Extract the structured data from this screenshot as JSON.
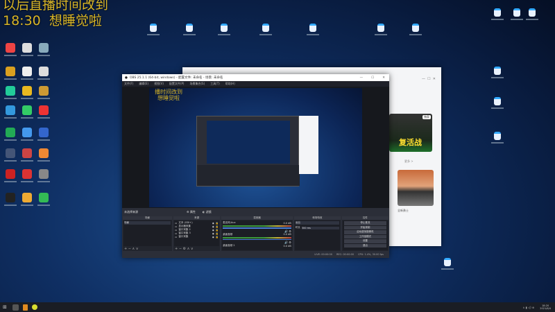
{
  "overlay": {
    "line1": "以后直播时间改到",
    "line2_time": "18:30",
    "line2_text": "想睡觉啦"
  },
  "desktop": {
    "left_icons": [
      "#e44",
      "#ddd",
      "#8ab",
      "#d9a020",
      "#eee",
      "#ddd",
      "#2c9",
      "#e8b820",
      "#c93",
      "#39d",
      "#3c6",
      "#e33",
      "#2a5",
      "#49e",
      "#36c",
      "#457",
      "#c44",
      "#e83",
      "#c22",
      "#d33",
      "#888",
      "#222",
      "#ea3",
      "#3b5"
    ],
    "right_icons": [
      "#3af",
      "#3af",
      "#3af",
      "#3af",
      "#3af",
      "#3af",
      "#3af",
      "#3af",
      "#3af",
      "#3af",
      "#3af",
      "#3af",
      "#3af",
      "#3af"
    ]
  },
  "browser": {
    "banner_text": "复活战",
    "badge": "独家",
    "more": "更多 >",
    "card_caption": "全新勇士"
  },
  "obs": {
    "title": "OBS 25.1.1 (64-bit, windows) - 配置文件: 未命名 - 场景: 未命名",
    "menu": [
      "文件(F)",
      "编辑(E)",
      "视图(V)",
      "配置文件(P)",
      "场景集合(S)",
      "工具(T)",
      "帮助(H)"
    ],
    "preview_overlay": {
      "line1": "播时间改到",
      "line2": "想睡觉啦"
    },
    "source_bar": {
      "label": "未选择来源",
      "properties": "属性",
      "filters": "滤镜"
    },
    "docks": {
      "scenes": {
        "title": "场景",
        "items": [
          "场景"
        ]
      },
      "sources": {
        "title": "来源",
        "items": [
          "文本 (GDI+)",
          "显示器采集",
          "窗口采集 2",
          "窗口采集 3",
          "窗口采集"
        ]
      },
      "mixer": {
        "title": "混音器",
        "channels": [
          {
            "name": "麦克风/Aux",
            "db": "0.0 dB"
          },
          {
            "name": "桌面音频",
            "db": "0.0 dB"
          },
          {
            "name": "桌面音频 2",
            "db": "0.0 dB"
          }
        ]
      },
      "transitions": {
        "title": "转场特效",
        "selected": "淡出",
        "duration_label": "时长",
        "duration": "300 ms"
      },
      "controls": {
        "title": "控件",
        "buttons": [
          "停止推流",
          "开始录制",
          "启动虚拟摄像机",
          "工作室模式",
          "设置",
          "退出"
        ]
      }
    },
    "status": [
      "LIVE: 00:00:00",
      "REC: 00:00:00",
      "CPU: 1.4%, 30.00 fps"
    ]
  },
  "taskbar": {
    "time": "18:20",
    "date": "2021/6/4"
  }
}
